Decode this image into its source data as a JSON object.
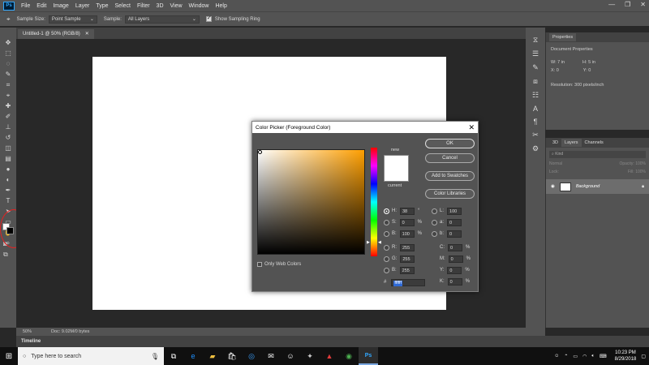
{
  "menu": {
    "logo": "Ps",
    "items": [
      "File",
      "Edit",
      "Image",
      "Layer",
      "Type",
      "Select",
      "Filter",
      "3D",
      "View",
      "Window",
      "Help"
    ]
  },
  "options": {
    "sample_size_label": "Sample Size:",
    "sample_size_value": "Point Sample",
    "sample_label": "Sample:",
    "sample_value": "All Layers",
    "sampling_ring_label": "Show Sampling Ring"
  },
  "document": {
    "tab_title": "Untitled-1 @ 50% (RGB/8)",
    "zoom": "50%",
    "doc_info": "Doc: 9.02M/0 bytes"
  },
  "timeline_label": "Timeline",
  "properties_panel": {
    "tab": "Properties",
    "header": "Document Properties",
    "w_label": "W:",
    "w_value": "7 in",
    "h_label": "H:",
    "h_value": "5 in",
    "x_label": "X:",
    "x_value": "0",
    "y_label": "Y:",
    "y_value": "0",
    "resolution": "Resolution: 300 pixels/inch"
  },
  "layers_panel": {
    "tabs": [
      "3D",
      "Layers",
      "Channels"
    ],
    "kind_label": "Kind",
    "blend_mode": "Normal",
    "opacity_label": "Opacity:",
    "opacity_value": "100%",
    "lock_label": "Lock:",
    "fill_label": "Fill:",
    "fill_value": "100%",
    "layer_name": "Background"
  },
  "picker": {
    "title": "Color Picker (Foreground Color)",
    "new_label": "new",
    "current_label": "current",
    "ok": "OK",
    "cancel": "Cancel",
    "add_swatches": "Add to Swatches",
    "libraries": "Color Libraries",
    "web_colors": "Only Web Colors",
    "hex_label": "#",
    "hex": "ffffff",
    "hsb": {
      "h": "38",
      "s": "0",
      "b": "100"
    },
    "hsb_units": {
      "h": "°",
      "s": "%",
      "b": "%"
    },
    "rgb": {
      "r": "255",
      "g": "255",
      "b": "255"
    },
    "lab": {
      "l": "100",
      "a": "0",
      "b": "0"
    },
    "cmyk": {
      "c": "0",
      "m": "0",
      "y": "0",
      "k": "0"
    },
    "pct": "%"
  },
  "taskbar": {
    "search_placeholder": "Type here to search",
    "time": "10:23 PM",
    "date": "8/29/2018"
  },
  "colors": {
    "selected_hue": "#ff9f00",
    "annotation": "#e52020"
  }
}
